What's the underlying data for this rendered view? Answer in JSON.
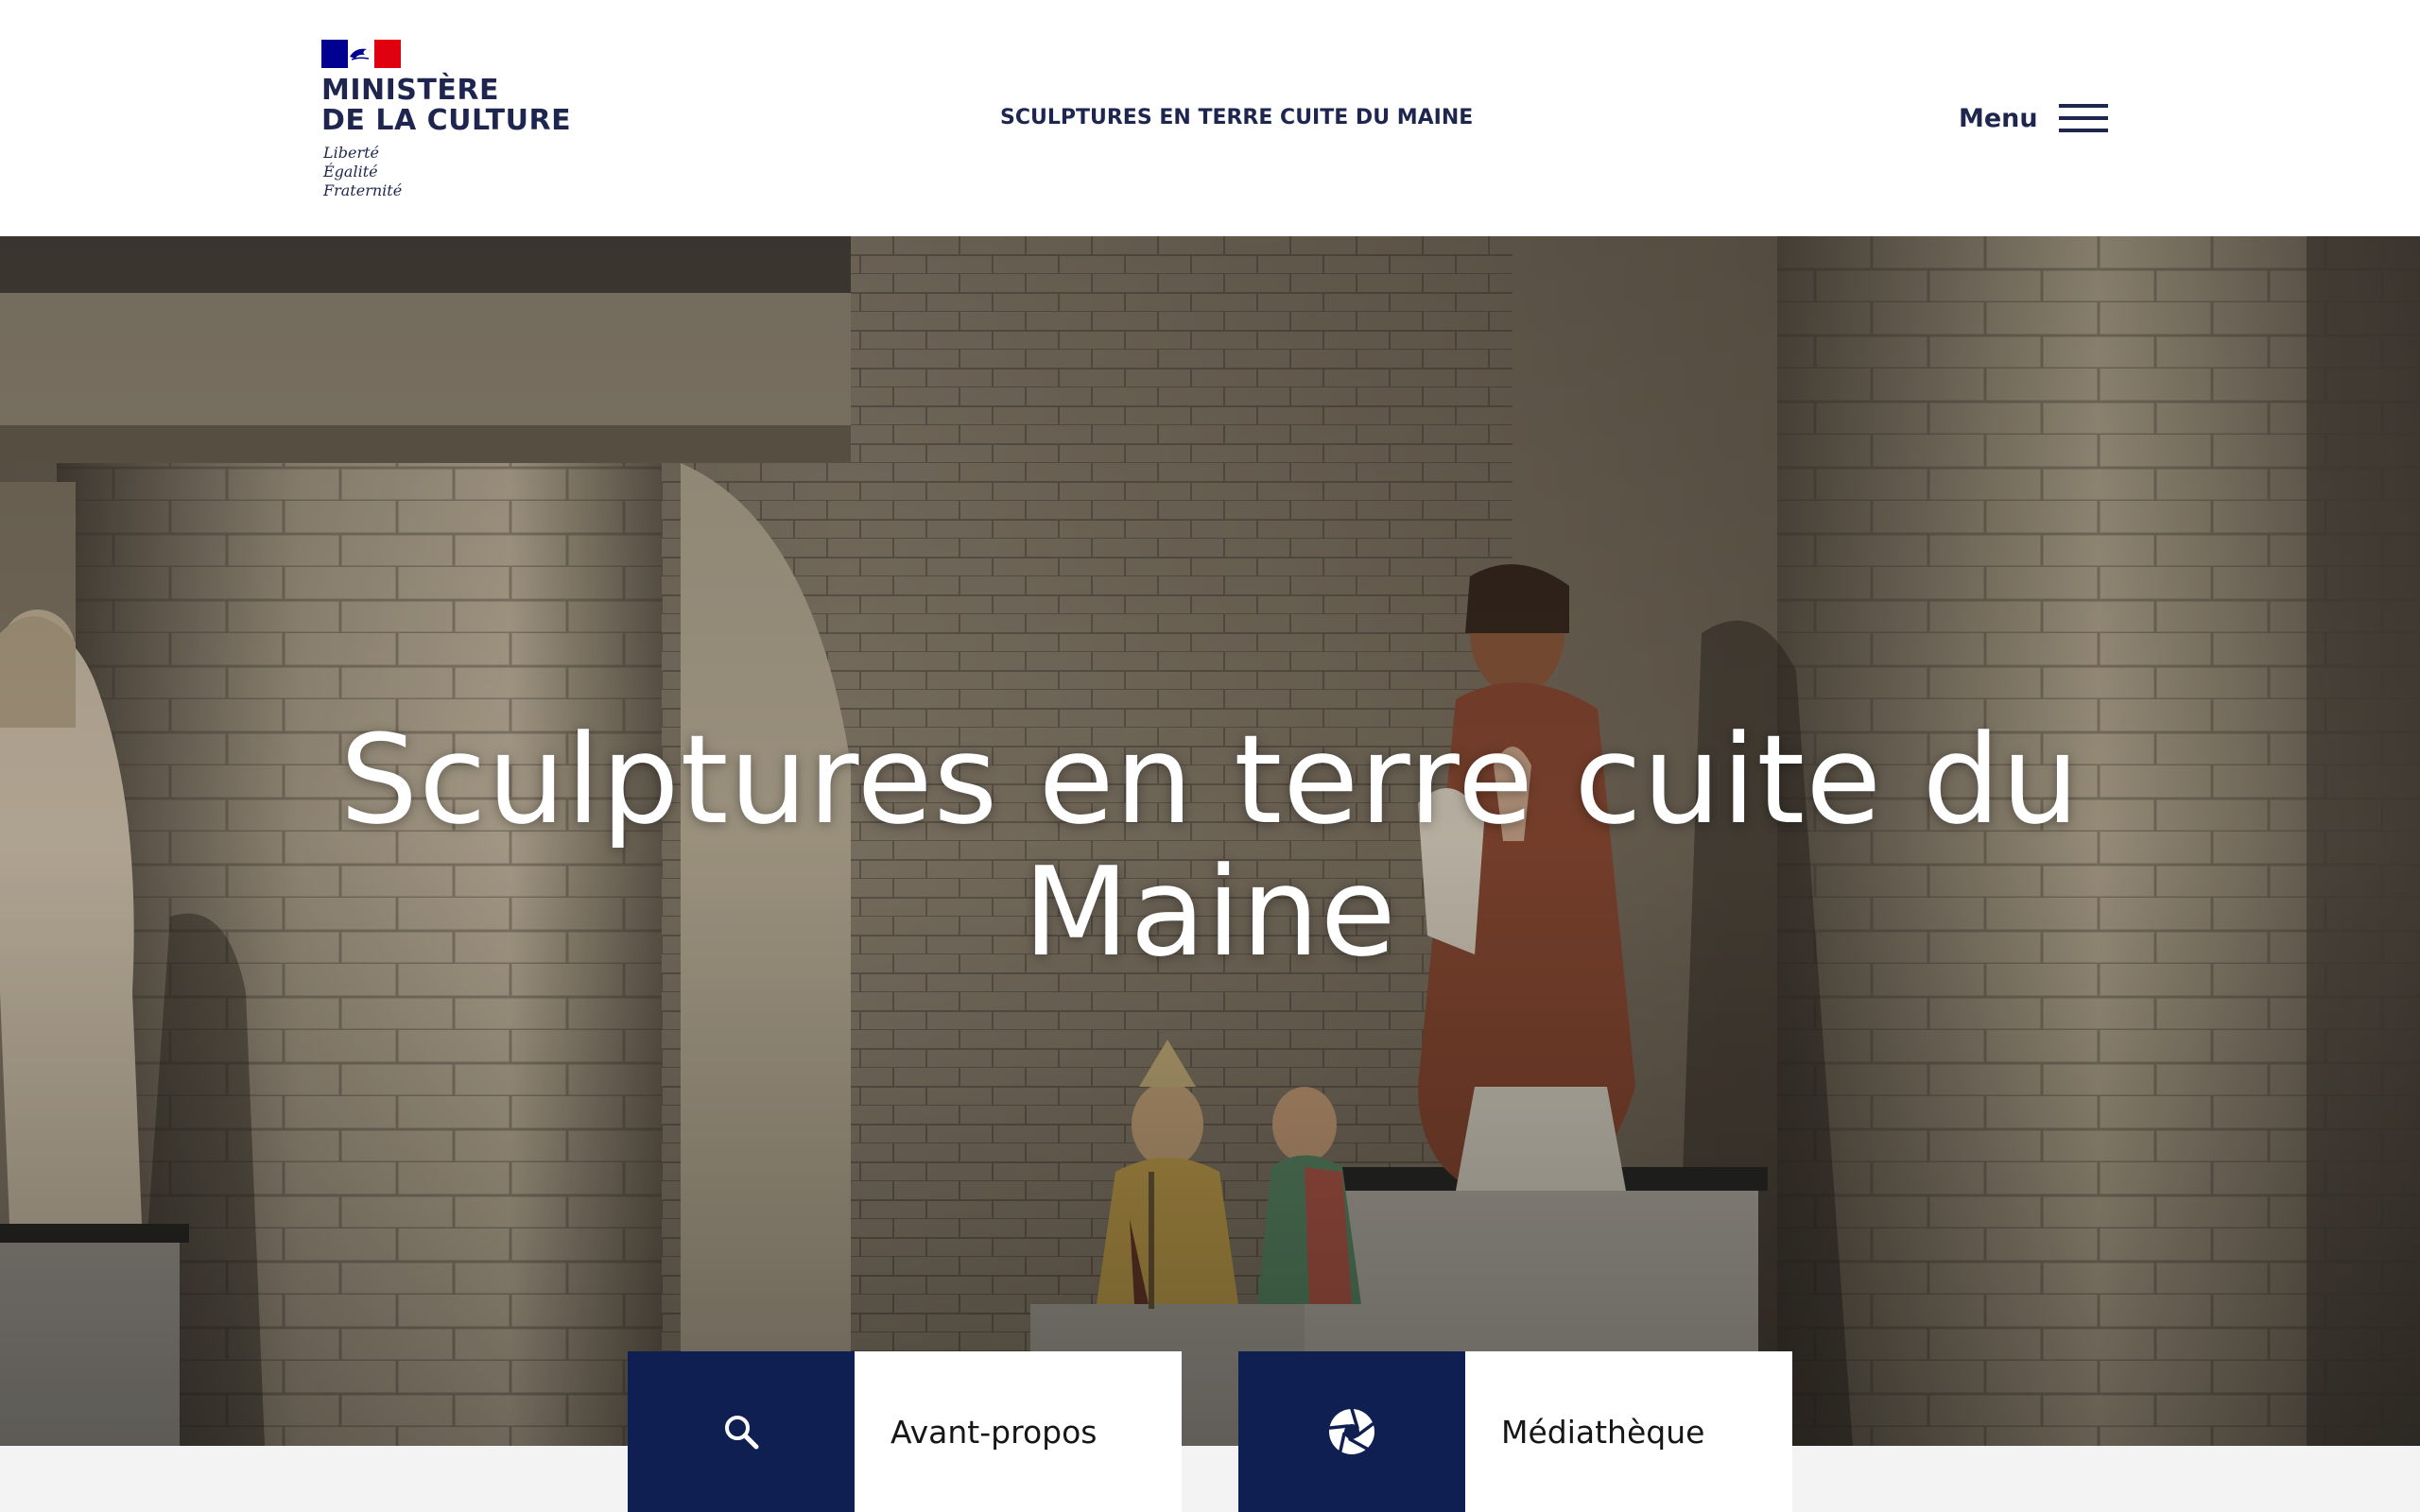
{
  "header": {
    "ministry_name_line1": "MINISTÈRE",
    "ministry_name_line2": "DE LA CULTURE",
    "motto_line1": "Liberté",
    "motto_line2": "Égalité",
    "motto_line3": "Fraternité",
    "site_title": "SCULPTURES EN TERRE CUITE DU MAINE",
    "menu_label": "Menu",
    "menu_icon": "hamburger-icon"
  },
  "hero": {
    "title": "Sculptures en terre cuite du Maine"
  },
  "cards": [
    {
      "label": "Avant-propos",
      "icon": "search-icon"
    },
    {
      "label": "Médiathèque",
      "icon": "camera-aperture-icon"
    }
  ],
  "colors": {
    "navy": "#0f1f52",
    "text_dark": "#1e2650",
    "flag_blue": "#000091",
    "flag_red": "#e1000f",
    "band": "#f3f3f3"
  }
}
